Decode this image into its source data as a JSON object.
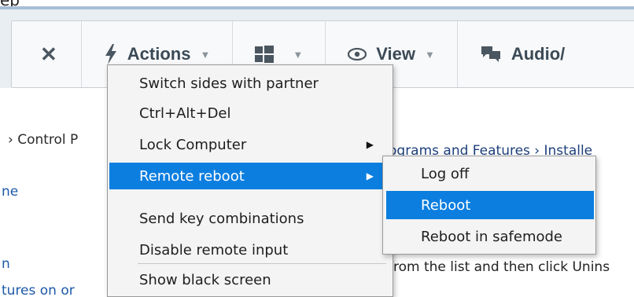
{
  "top_fragment": "ep",
  "toolbar": {
    "close_label": "✕",
    "actions_label": "Actions",
    "windows_label": "",
    "view_label": "View",
    "audio_label": "Audio/"
  },
  "background": {
    "breadcrumb_left": "› Control P",
    "breadcrumb_right": "ograms and Features › Installe",
    "sidebar_1": "ne",
    "sidebar_2": "n",
    "sidebar_3": "tures on or",
    "body_line": "from the list and then click Unins"
  },
  "actions_menu": {
    "items": [
      {
        "label": "Switch sides with partner"
      },
      {
        "label": "Ctrl+Alt+Del"
      },
      {
        "label": "Lock Computer"
      },
      {
        "label": "Remote reboot"
      },
      {
        "label": "Send key combinations"
      },
      {
        "label": "Disable remote input"
      },
      {
        "label": "Show black screen"
      }
    ]
  },
  "reboot_submenu": {
    "items": [
      {
        "label": "Log off"
      },
      {
        "label": "Reboot"
      },
      {
        "label": "Reboot in safemode"
      }
    ]
  },
  "colors": {
    "highlight": "#0b7ee0",
    "toolbar_text": "#3b4a56"
  }
}
